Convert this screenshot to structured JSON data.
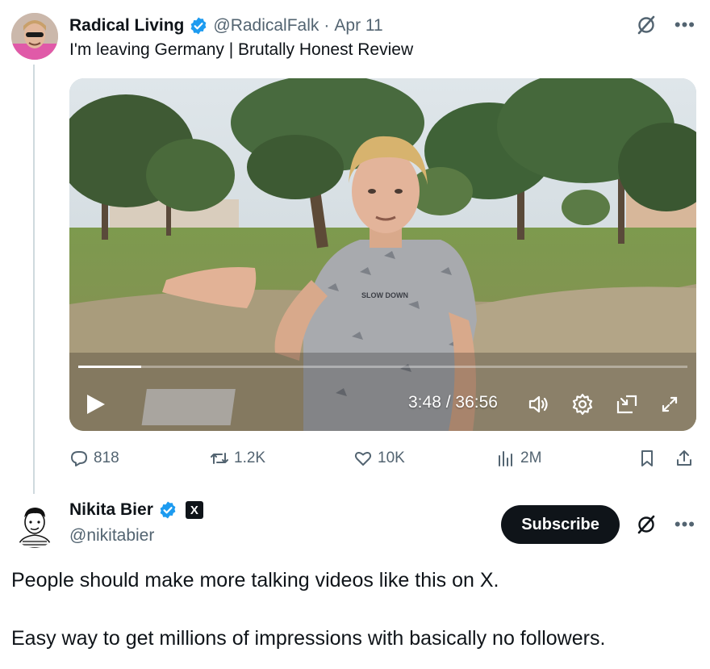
{
  "quoted_tweet": {
    "author_name": "Radical Living",
    "handle": "@RadicalFalk",
    "separator": "·",
    "date": "Apr 11",
    "text": "I'm leaving Germany | Brutally Honest Review",
    "video": {
      "shirt_text": "SLOW DOWN",
      "current_time": "3:48",
      "time_sep": "/",
      "duration": "36:56",
      "progress_fraction": 0.103
    },
    "actions": {
      "replies": "818",
      "reposts": "1.2K",
      "likes": "10K",
      "views": "2M"
    }
  },
  "reply_tweet": {
    "author_name": "Nikita Bier",
    "handle": "@nikitabier",
    "affiliate_badge": "X",
    "subscribe_label": "Subscribe",
    "text_line_1": "People should make more talking videos like this on X.",
    "text_line_2": "Easy way to get millions of impressions with basically no followers."
  },
  "colors": {
    "verified_blue": "#1d9bf0",
    "muted": "#536471",
    "text": "#0f1419"
  },
  "icons": [
    "verified-icon",
    "grok-icon",
    "more-icon",
    "play-icon",
    "volume-icon",
    "settings-icon",
    "pip-icon",
    "fullscreen-icon",
    "reply-icon",
    "repost-icon",
    "like-icon",
    "views-icon",
    "bookmark-icon",
    "share-icon"
  ]
}
